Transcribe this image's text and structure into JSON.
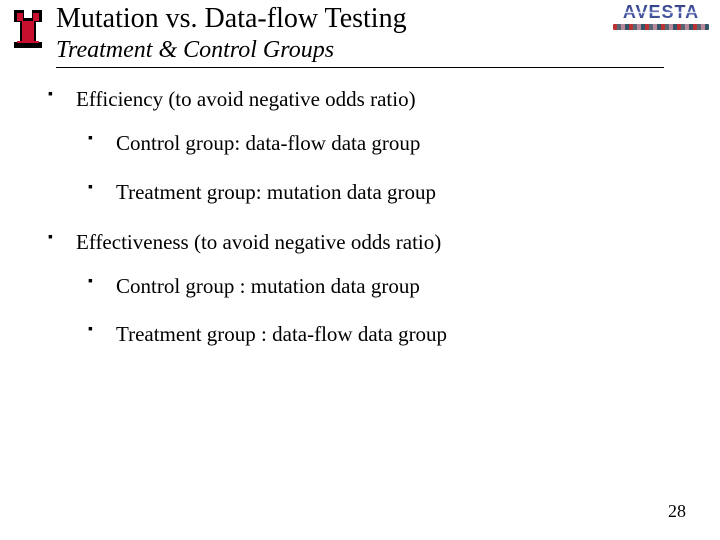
{
  "header": {
    "title": "Mutation vs. Data-flow Testing",
    "subtitle": "Treatment & Control Groups",
    "right_logo_text": "AVESTA"
  },
  "body": {
    "items": [
      {
        "text": "Efficiency (to avoid negative odds ratio)",
        "children": [
          "Control group: data-flow data group",
          "Treatment group: mutation data group"
        ]
      },
      {
        "text": "Effectiveness (to avoid negative odds ratio)",
        "children": [
          "Control group : mutation data group",
          "Treatment group : data-flow data group"
        ]
      }
    ]
  },
  "footer": {
    "slide_number": "28"
  }
}
